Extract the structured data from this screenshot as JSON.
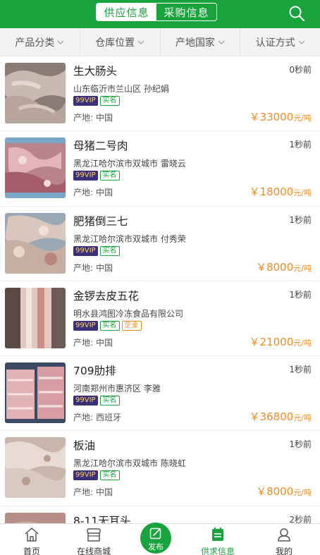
{
  "header": {
    "tabs": [
      {
        "label": "供应信息",
        "active": true
      },
      {
        "label": "采购信息",
        "active": false
      }
    ],
    "search_icon": "search-icon",
    "brand_color": "#19a33c"
  },
  "filters": [
    {
      "label": "产品分类"
    },
    {
      "label": "仓库位置"
    },
    {
      "label": "产地国家"
    },
    {
      "label": "认证方式"
    }
  ],
  "listings": [
    {
      "title": "生大肠头",
      "time": "0秒前",
      "location": "山东临沂市兰山区  孙纪娟",
      "badges": {
        "vip": "99VIP",
        "real": "实名"
      },
      "origin_label": "产地:",
      "origin": "中国",
      "price": "￥33000",
      "unit": "元/吨"
    },
    {
      "title": "母猪二号肉",
      "time": "1秒前",
      "location": "黑龙江哈尔滨市双城市  雷晓云",
      "badges": {
        "vip": "99VIP",
        "real": "实名"
      },
      "origin_label": "产地:",
      "origin": "中国",
      "price": "￥18000",
      "unit": "元/吨"
    },
    {
      "title": "肥猪倒三七",
      "time": "1秒前",
      "location": "黑龙江哈尔滨市双城市  付秀荣",
      "badges": {
        "vip": "99VIP",
        "real": "实名"
      },
      "origin_label": "产地:",
      "origin": "中国",
      "price": "￥8000",
      "unit": "元/吨"
    },
    {
      "title": "金锣去皮五花",
      "time": "1秒前",
      "location": "明水县鸿图冷冻食品有限公司",
      "badges": {
        "vip": "99VIP",
        "real": "实名",
        "enterprise": "企业"
      },
      "origin_label": "产地:",
      "origin": "中国",
      "price": "￥21000",
      "unit": "元/吨"
    },
    {
      "title": "709肋排",
      "time": "1秒前",
      "location": "河南郑州市惠济区  李雅",
      "badges": {
        "vip": "99VIP",
        "real": "实名"
      },
      "origin_label": "产地:",
      "origin": "西班牙",
      "price": "￥36800",
      "unit": "元/吨"
    },
    {
      "title": "板油",
      "time": "1秒前",
      "location": "黑龙江哈尔滨市双城市  陈晓虹",
      "badges": {
        "vip": "99VIP",
        "real": "实名"
      },
      "origin_label": "产地:",
      "origin": "中国",
      "price": "￥8000",
      "unit": "元/吨"
    },
    {
      "title": "8-11无耳头",
      "time": "2秒前",
      "location": "",
      "badges": {
        "vip": "",
        "real": ""
      },
      "origin_label": "",
      "origin": "",
      "price": "",
      "unit": ""
    }
  ],
  "bottom_nav": [
    {
      "label": "首页",
      "icon": "home-icon",
      "active": false
    },
    {
      "label": "在线商城",
      "icon": "shop-icon",
      "active": false
    },
    {
      "label": "发布",
      "icon": "publish-icon",
      "active": false
    },
    {
      "label": "供求信息",
      "icon": "info-list-icon",
      "active": true
    },
    {
      "label": "我的",
      "icon": "user-icon",
      "active": false
    }
  ],
  "colors": {
    "price": "#f08a1d",
    "vip_bg": "#3b2f7a",
    "accent": "#19a33c"
  }
}
